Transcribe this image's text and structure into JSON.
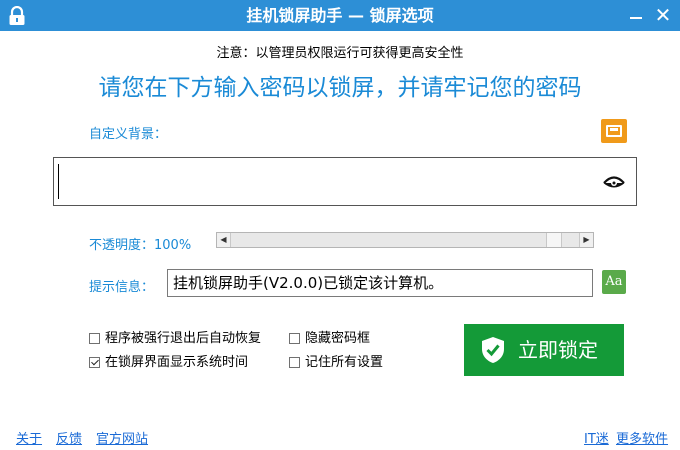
{
  "window": {
    "title": "挂机锁屏助手 — 锁屏选项",
    "close_glyph": "✕"
  },
  "notice": "注意：以管理员权限运行可获得更高安全性",
  "headline": "请您在下方输入密码以锁屏，并请牢记您的密码",
  "background": {
    "label": "自定义背景："
  },
  "password": {
    "value": ""
  },
  "opacity": {
    "label": "不透明度：100%",
    "fraction": 0.95,
    "arrow_left": "◀",
    "arrow_right": "▶"
  },
  "hint": {
    "label": "提示信息：",
    "value": "挂机锁屏助手(V2.0.0)已锁定该计算机。",
    "font_button": "Aa"
  },
  "options": {
    "auto_restore": {
      "label": "程序被强行退出后自动恢复",
      "checked": false
    },
    "hide_password": {
      "label": "隐藏密码框",
      "checked": false
    },
    "show_time": {
      "label": "在锁屏界面显示系统时间",
      "checked": true
    },
    "remember_all": {
      "label": "记住所有设置",
      "checked": false
    }
  },
  "lock_button": {
    "label": "立即锁定"
  },
  "footer": {
    "about": "关于",
    "feedback": "反馈",
    "website": "官方网站",
    "it_fan": "IT迷",
    "more_software": "更多软件"
  },
  "colors": {
    "titlebar": "#2d8fd6",
    "accent_text": "#1a8ad6",
    "lock_button": "#149a38",
    "folder_icon": "#f09a1a",
    "font_icon": "#5aaa4a"
  },
  "icons": {
    "title": "lock-icon",
    "background_picker": "folder-icon",
    "password_toggle": "eye-icon",
    "font_picker": "font-icon",
    "lock_button": "shield-check-icon"
  }
}
